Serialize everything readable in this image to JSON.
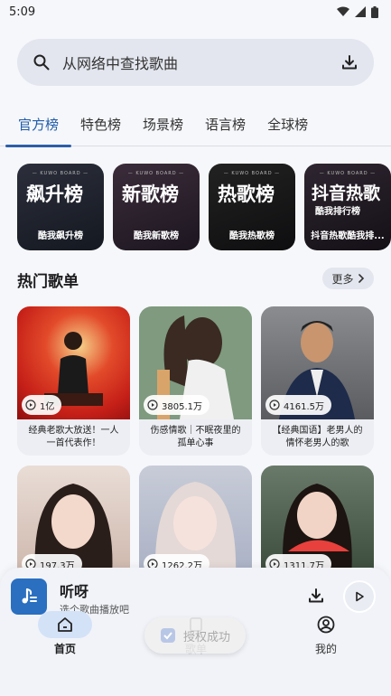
{
  "status_bar": {
    "time": "5:09"
  },
  "search": {
    "placeholder": "从网络中查找歌曲"
  },
  "tabs": [
    {
      "label": "官方榜",
      "active": true
    },
    {
      "label": "特色榜"
    },
    {
      "label": "场景榜"
    },
    {
      "label": "语言榜"
    },
    {
      "label": "全球榜"
    }
  ],
  "charts": [
    {
      "brand": "— KUWO BOARD —",
      "title": "飙升榜",
      "subtitle": "",
      "caption": "酷我飙升榜"
    },
    {
      "brand": "— KUWO BOARD —",
      "title": "新歌榜",
      "subtitle": "",
      "caption": "酷我新歌榜"
    },
    {
      "brand": "— KUWO BOARD —",
      "title": "热歌榜",
      "subtitle": "",
      "caption": "酷我热歌榜"
    },
    {
      "brand": "— KUWO BOARD —",
      "title": "抖音热歌",
      "subtitle": "酷我排行榜",
      "caption": "抖音热歌酷我排..."
    }
  ],
  "section": {
    "title": "热门歌单",
    "more_label": "更多"
  },
  "playlists": [
    {
      "count": "1亿",
      "title": "经典老歌大放送！一人一首代表作！"
    },
    {
      "count": "3805.1万",
      "title": "伤感情歌｜不眠夜里的孤单心事"
    },
    {
      "count": "4161.5万",
      "title": "【经典国语】老男人的情怀老男人的歌"
    },
    {
      "count": "197.3万",
      "title": ""
    },
    {
      "count": "1262.2万",
      "title": ""
    },
    {
      "count": "1311.7万",
      "title": ""
    }
  ],
  "player": {
    "title": "听呀",
    "subtitle": "选个歌曲播放吧"
  },
  "nav": [
    {
      "label": "首页",
      "icon": "home-icon",
      "active": true
    },
    {
      "label": "歌单",
      "icon": "playlist-icon"
    },
    {
      "label": "我的",
      "icon": "profile-icon"
    }
  ],
  "toast": {
    "text": "授权成功"
  },
  "colors": {
    "accent": "#1f5ba7",
    "background": "#f6f7fb"
  }
}
